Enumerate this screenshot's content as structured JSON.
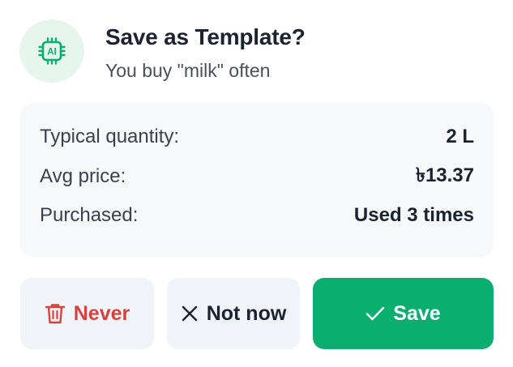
{
  "dialog": {
    "title": "Save as Template?",
    "subtitle": "You buy \"milk\" often",
    "badge_icon": "ai-chip-icon",
    "badge_text": "AI"
  },
  "stats": [
    {
      "label": "Typical quantity:",
      "value": "2 L"
    },
    {
      "label": "Avg price:",
      "value": "৳13.37"
    },
    {
      "label": "Purchased:",
      "value": "Used 3 times"
    }
  ],
  "actions": {
    "never_label": "Never",
    "never_icon": "trash-icon",
    "not_now_label": "Not now",
    "not_now_icon": "close-icon",
    "save_label": "Save",
    "save_icon": "check-icon"
  },
  "colors": {
    "accent_green": "#0aae6f",
    "badge_bg": "#e6f5ee",
    "danger_red": "#d9423c",
    "secondary_btn_bg": "#f0f3f8",
    "stats_bg": "#f7f8f9"
  }
}
